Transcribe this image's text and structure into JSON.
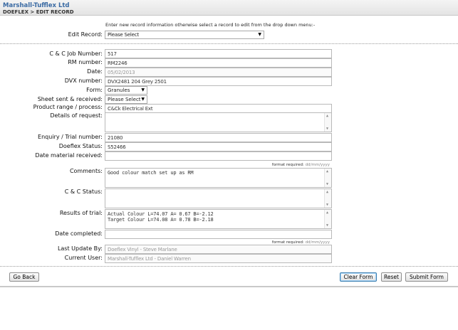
{
  "header": {
    "company": "Marshall-Tufflex Ltd",
    "breadcrumb": "DOEFLEX > EDIT RECORD"
  },
  "intro_text": "Enter new record information otherwise select a record to edit from the drop down menu:-",
  "edit_record": {
    "label": "Edit Record:",
    "value": "Please Select"
  },
  "form": {
    "job_number": {
      "label": "C & C Job Number:",
      "value": "517"
    },
    "rm_number": {
      "label": "RM number:",
      "value": "RM2246"
    },
    "date": {
      "label": "Date:",
      "value": "05/02/2013"
    },
    "dvx_number": {
      "label": "DVX number:",
      "value": "DVX2481 204 Grey 2501"
    },
    "form_select": {
      "label": "Form:",
      "value": "Granules"
    },
    "sheet_sent": {
      "label": "Sheet sent & received:",
      "value": "Please Select"
    },
    "product_range": {
      "label": "Product range / process:",
      "value": "C&Ck Electrical Ext"
    },
    "details": {
      "label": "Details of request:",
      "value": ""
    },
    "enquiry": {
      "label": "Enquiry / Trial number:",
      "value": "21080"
    },
    "doeflex_status": {
      "label": "Doeflex Status:",
      "value": "S52466"
    },
    "date_material": {
      "label": "Date material received:",
      "value": ""
    },
    "format_hint_1": {
      "text": "format required:",
      "format": "dd/mm/yyyy"
    },
    "comments": {
      "label": "Comments:",
      "value": "Good colour match set up as RM"
    },
    "cc_status": {
      "label": "C & C Status:",
      "value": ""
    },
    "results": {
      "label": "Results of trial:",
      "lines": [
        "Actual Colour L=74.07 A= 0.67 B=-2.12",
        "Target Colour L=74.08 A= 0.78 B=-2.18"
      ]
    },
    "date_completed": {
      "label": "Date completed:",
      "value": ""
    },
    "format_hint_2": {
      "text": "format required:",
      "format": "dd/mm/yyyy"
    },
    "last_update": {
      "label": "Last Update By:",
      "value": "Doeflex Vinyl - Steve Marlane"
    },
    "current_user": {
      "label": "Current User:",
      "value": "Marshall-Tufflex Ltd - Daniel Warren"
    }
  },
  "buttons": {
    "go_back": "Go Back",
    "clear_form": "Clear Form",
    "reset": "Reset",
    "submit_form": "Submit Form"
  },
  "colors": {
    "brand": "#3a6aa3",
    "focus": "#3c7fb1"
  }
}
